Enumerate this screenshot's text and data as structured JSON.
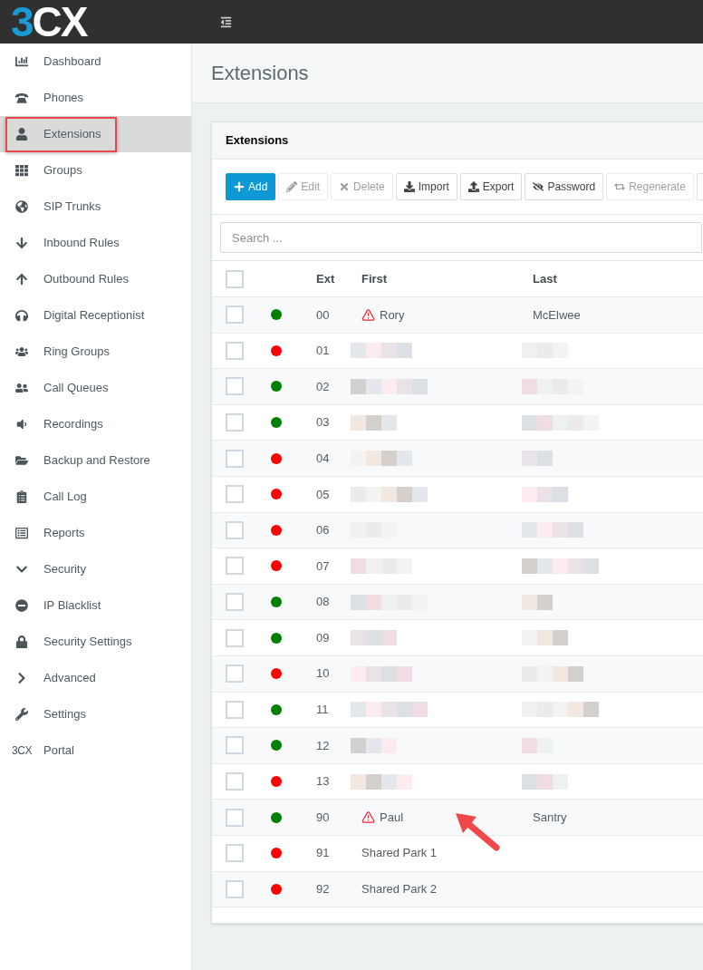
{
  "header": {
    "logo": "3CX"
  },
  "sidebar": {
    "items": [
      {
        "label": "Dashboard",
        "selected": false
      },
      {
        "label": "Phones",
        "selected": false
      },
      {
        "label": "Extensions",
        "selected": true
      },
      {
        "label": "Groups",
        "selected": false
      },
      {
        "label": "SIP Trunks",
        "selected": false
      },
      {
        "label": "Inbound Rules",
        "selected": false
      },
      {
        "label": "Outbound Rules",
        "selected": false
      },
      {
        "label": "Digital Receptionist",
        "selected": false
      },
      {
        "label": "Ring Groups",
        "selected": false
      },
      {
        "label": "Call Queues",
        "selected": false
      },
      {
        "label": "Recordings",
        "selected": false
      },
      {
        "label": "Backup and Restore",
        "selected": false
      },
      {
        "label": "Call Log",
        "selected": false
      },
      {
        "label": "Reports",
        "selected": false
      },
      {
        "label": "Security",
        "selected": false
      },
      {
        "label": "IP Blacklist",
        "selected": false
      },
      {
        "label": "Security Settings",
        "selected": false
      },
      {
        "label": "Advanced",
        "selected": false
      },
      {
        "label": "Settings",
        "selected": false
      },
      {
        "label": "Portal",
        "selected": false,
        "logo": "3CX"
      }
    ]
  },
  "page_title": "Extensions",
  "card": {
    "title": "Extensions",
    "toolbar": [
      {
        "label": "Add",
        "kind": "primary",
        "disabled": false
      },
      {
        "label": "Edit",
        "kind": "default",
        "disabled": true
      },
      {
        "label": "Delete",
        "kind": "default",
        "disabled": true
      },
      {
        "label": "Import",
        "kind": "default",
        "disabled": false
      },
      {
        "label": "Export",
        "kind": "default",
        "disabled": false
      },
      {
        "label": "Password",
        "kind": "default",
        "disabled": false
      },
      {
        "label": "Regenerate",
        "kind": "default",
        "disabled": true
      }
    ],
    "search": {
      "placeholder": "Search ..."
    },
    "table": {
      "select_all": {
        "checked": false
      },
      "columns": [
        "Ext",
        "First",
        "Last"
      ],
      "rows": [
        {
          "ext": "00",
          "color": "#008000",
          "warning": true,
          "redacted": false,
          "first": "Rory",
          "last": "McElwee",
          "checked": false
        },
        {
          "ext": "01",
          "color": "#ff0000",
          "warning": false,
          "redacted": true,
          "checked": false
        },
        {
          "ext": "02",
          "color": "#008000",
          "warning": false,
          "redacted": true,
          "checked": false
        },
        {
          "ext": "03",
          "color": "#008000",
          "warning": false,
          "redacted": true,
          "checked": false
        },
        {
          "ext": "04",
          "color": "#ff0000",
          "warning": false,
          "redacted": true,
          "checked": false
        },
        {
          "ext": "05",
          "color": "#ff0000",
          "warning": false,
          "redacted": true,
          "checked": false
        },
        {
          "ext": "06",
          "color": "#ff0000",
          "warning": false,
          "redacted": true,
          "checked": false
        },
        {
          "ext": "07",
          "color": "#ff0000",
          "warning": false,
          "redacted": true,
          "checked": false
        },
        {
          "ext": "08",
          "color": "#008000",
          "warning": false,
          "redacted": true,
          "checked": false
        },
        {
          "ext": "09",
          "color": "#008000",
          "warning": false,
          "redacted": true,
          "checked": false
        },
        {
          "ext": "10",
          "color": "#ff0000",
          "warning": false,
          "redacted": true,
          "checked": false
        },
        {
          "ext": "11",
          "color": "#008000",
          "warning": false,
          "redacted": true,
          "checked": false
        },
        {
          "ext": "12",
          "color": "#008000",
          "warning": false,
          "redacted": true,
          "checked": false
        },
        {
          "ext": "13",
          "color": "#ff0000",
          "warning": false,
          "redacted": true,
          "checked": false
        },
        {
          "ext": "90",
          "color": "#008000",
          "warning": true,
          "redacted": false,
          "first": "Paul",
          "last": "Santry",
          "checked": false
        },
        {
          "ext": "91",
          "color": "#ff0000",
          "warning": false,
          "redacted": false,
          "first": "Shared Park 1",
          "checked": false
        },
        {
          "ext": "92",
          "color": "#ff0000",
          "warning": false,
          "redacted": false,
          "first": "Shared Park 2",
          "checked": false
        }
      ]
    }
  }
}
